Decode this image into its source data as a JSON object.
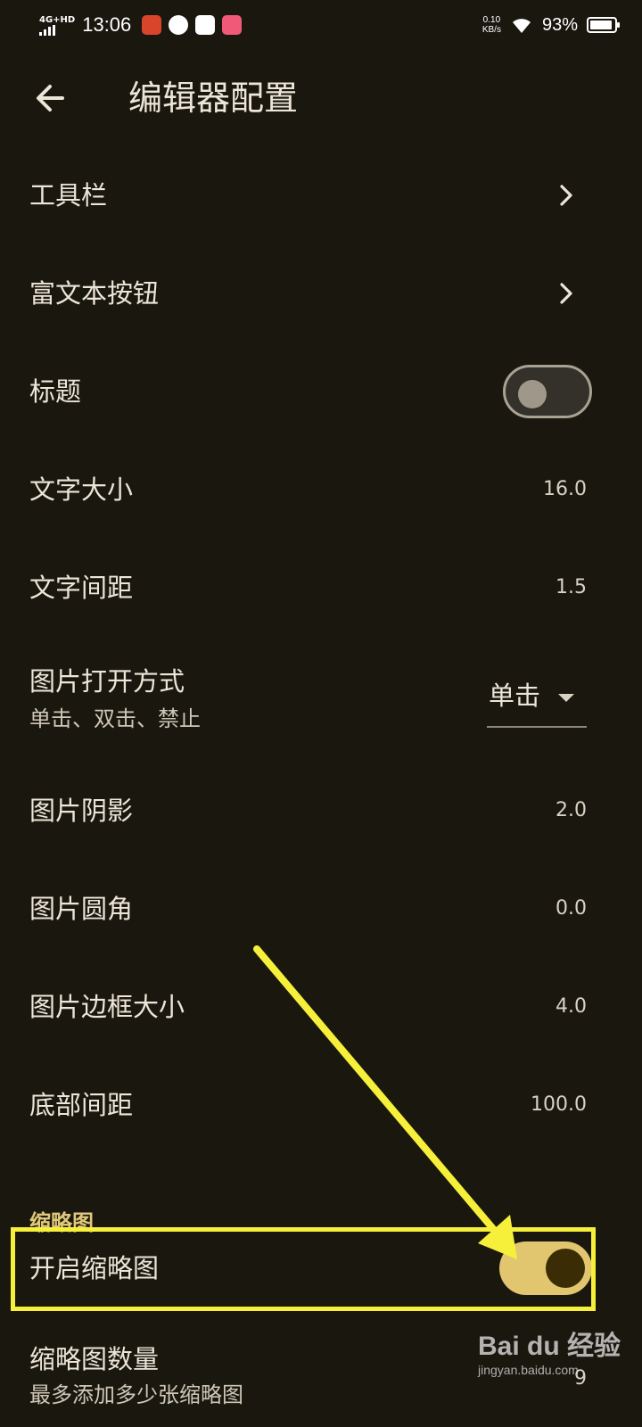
{
  "status_bar": {
    "network": "4G+HD",
    "time": "13:06",
    "speed_value": "0.10",
    "speed_unit": "KB/s",
    "battery_percent": "93%",
    "battery_level": 0.93
  },
  "header": {
    "title": "编辑器配置"
  },
  "settings": {
    "toolbar": {
      "label": "工具栏"
    },
    "rich_text_buttons": {
      "label": "富文本按钮"
    },
    "title": {
      "label": "标题",
      "enabled": false
    },
    "font_size": {
      "label": "文字大小",
      "value": "16.0"
    },
    "line_spacing": {
      "label": "文字间距",
      "value": "1.5"
    },
    "image_open_mode": {
      "label": "图片打开方式",
      "subtitle": "单击、双击、禁止",
      "selected": "单击"
    },
    "image_shadow": {
      "label": "图片阴影",
      "value": "2.0"
    },
    "image_corner": {
      "label": "图片圆角",
      "value": "0.0"
    },
    "image_border": {
      "label": "图片边框大小",
      "value": "4.0"
    },
    "bottom_padding": {
      "label": "底部间距",
      "value": "100.0"
    }
  },
  "thumbnail_section": {
    "header": "缩略图",
    "enable": {
      "label": "开启缩略图",
      "enabled": true
    },
    "count": {
      "label": "缩略图数量",
      "subtitle": "最多添加多少张缩略图",
      "value": "9"
    }
  },
  "watermark": {
    "main": "Bai du 经验",
    "sub": "jingyan.baidu.com"
  },
  "colors": {
    "background": "#1a170f",
    "accent": "#e2c66f",
    "annotation": "#f6f03a"
  }
}
